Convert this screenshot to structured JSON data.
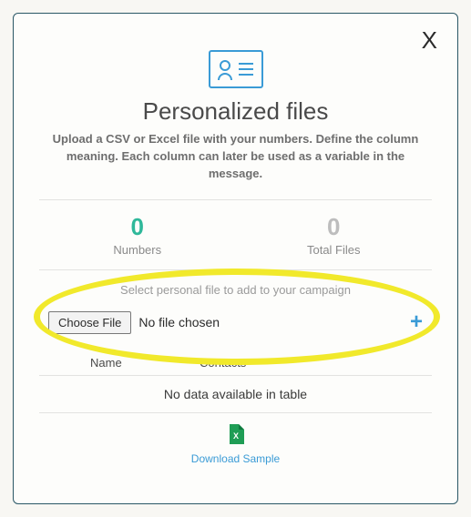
{
  "dialog": {
    "close_label": "X",
    "title": "Personalized files",
    "subtitle": "Upload a CSV or Excel file with your numbers. Define the column meaning. Each column can later be used as a variable in the message."
  },
  "stats": {
    "numbers": {
      "value": "0",
      "label": "Numbers"
    },
    "total_files": {
      "value": "0",
      "label": "Total Files"
    }
  },
  "file_section": {
    "caption": "Select personal file to add to your campaign",
    "choose_button": "Choose File",
    "status": "No file chosen",
    "add_symbol": "+"
  },
  "table": {
    "columns": {
      "name": "Name",
      "contacts": "Contacts"
    },
    "empty_message": "No data available in table"
  },
  "download": {
    "link_label": "Download Sample"
  }
}
